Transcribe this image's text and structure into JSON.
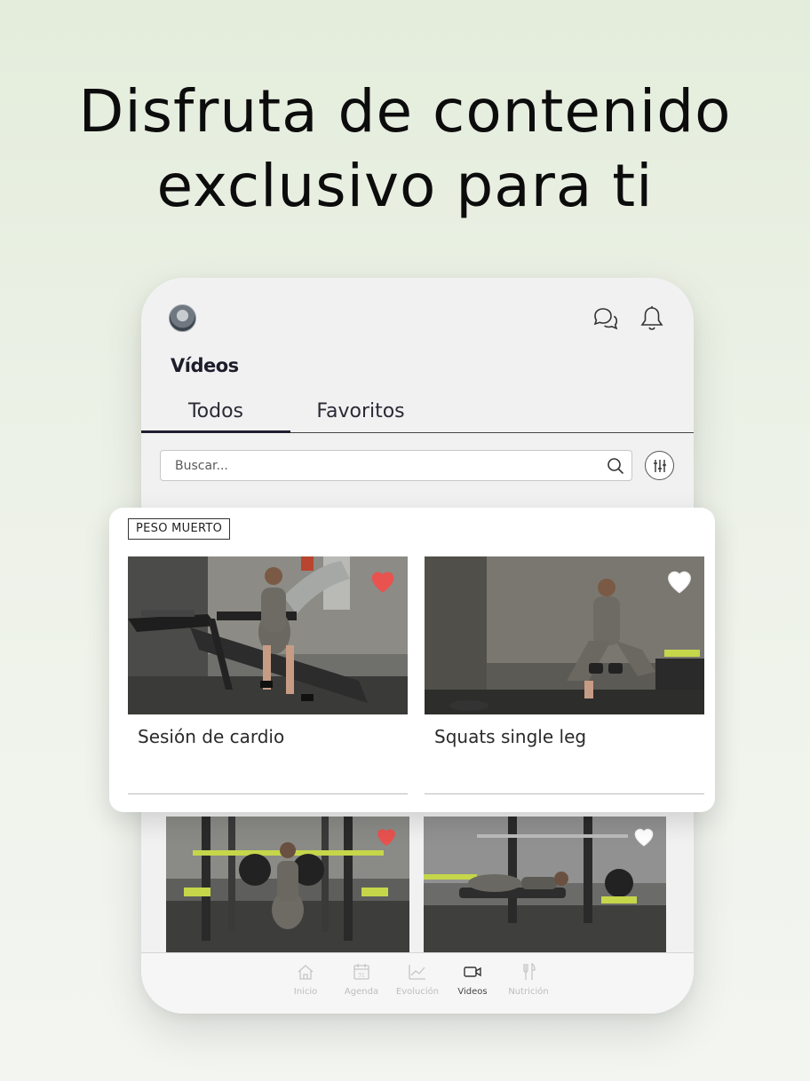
{
  "headline": {
    "line1": "Disfruta de contenido",
    "line2": "exclusivo para ti"
  },
  "app": {
    "page_title": "Vídeos",
    "tabs": [
      {
        "label": "Todos",
        "active": true
      },
      {
        "label": "Favoritos",
        "active": false
      }
    ],
    "search": {
      "placeholder": "Buscar..."
    },
    "category": "PESO MUERTO",
    "videos": [
      {
        "title": "Sesión de cardio",
        "favorite": true
      },
      {
        "title": "Squats single leg",
        "favorite": false
      }
    ],
    "more_videos": [
      {
        "favorite": true
      },
      {
        "favorite": false
      }
    ],
    "bottom_nav": [
      {
        "label": "Inicio",
        "icon": "home-icon",
        "active": false
      },
      {
        "label": "Agenda",
        "icon": "calendar-icon",
        "active": false
      },
      {
        "label": "Evolución",
        "icon": "chart-icon",
        "active": false
      },
      {
        "label": "Videos",
        "icon": "video-icon",
        "active": true
      },
      {
        "label": "Nutrición",
        "icon": "cutlery-icon",
        "active": false
      }
    ],
    "calendar_day": "31"
  },
  "colors": {
    "favorite_heart": "#e8524f",
    "background_top": "#e4eddc",
    "text_dark": "#1d1d2b"
  }
}
